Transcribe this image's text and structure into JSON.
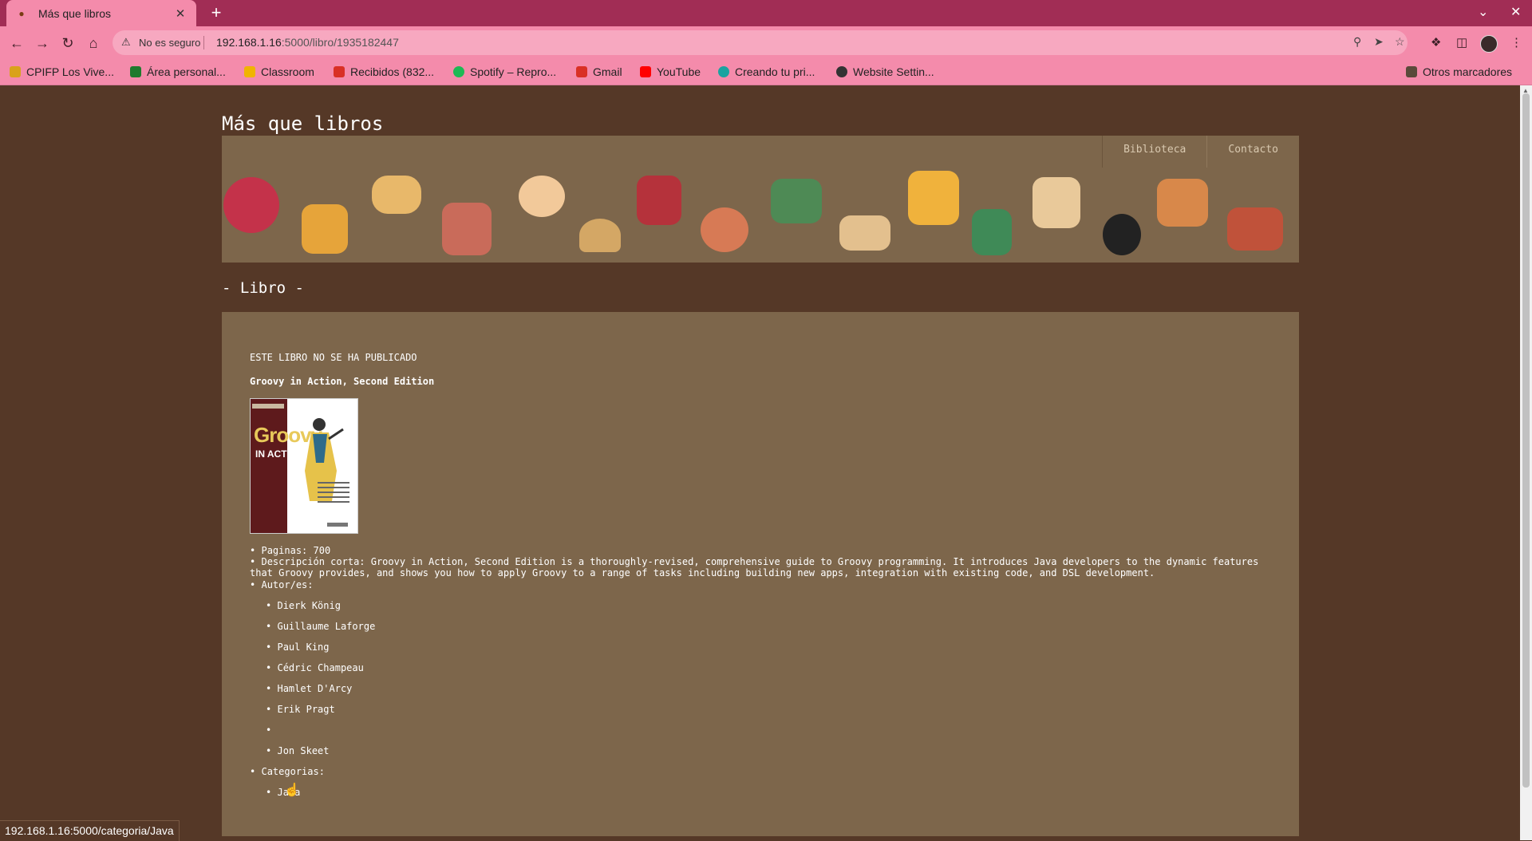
{
  "browser": {
    "tab_title": "Más que libros",
    "new_tab": "+",
    "tab_close": "✕",
    "security_label": "No es seguro",
    "url_host": "192.168.1.16",
    "url_path": ":5000/libro/1935182447",
    "window_controls": [
      "⌄",
      "✕"
    ],
    "bookmarks": [
      {
        "label": "CPIFP Los Vive...",
        "color": "#d9a21b"
      },
      {
        "label": "Área personal...",
        "color": "#1f7a2e"
      },
      {
        "label": "Classroom",
        "color": "#f0b400"
      },
      {
        "label": "Recibidos (832...",
        "color": "#d93025"
      },
      {
        "label": "Spotify – Repro...",
        "color": "#1db954"
      },
      {
        "label": "Gmail",
        "color": "#d93025"
      },
      {
        "label": "YouTube",
        "color": "#ff0000"
      },
      {
        "label": "Creando tu pri...",
        "color": "#1aa3a0"
      },
      {
        "label": "Website Settin...",
        "color": "#333333"
      }
    ],
    "other_bookmarks": "Otros marcadores",
    "status_url": "192.168.1.16:5000/categoria/Java"
  },
  "site": {
    "title": "Más que libros",
    "menu": [
      "Biblioteca",
      "Contacto"
    ],
    "section_title": "- Libro -"
  },
  "book": {
    "status": "ESTE LIBRO NO SE HA PUBLICADO",
    "title": "Groovy in Action, Second Edition",
    "cover_word": "Groovy",
    "cover_word2": "IN ACTION",
    "pages_label": "Paginas: 700",
    "description_line1": "Descripción corta: Groovy in Action, Second Edition is a thoroughly-revised, comprehensive guide to Groovy programming. It introduces Java developers to the dynamic features",
    "description_line2": "that Groovy provides, and shows you how to apply Groovy to a range of tasks including building new apps, integration with existing code, and DSL development.",
    "authors_label": "Autor/es:",
    "authors": [
      "Dierk König",
      "Guillaume Laforge",
      "Paul King",
      "Cédric Champeau",
      "Hamlet D'Arcy",
      "Erik Pragt",
      "",
      "Jon Skeet"
    ],
    "categories_label": "Categorias:",
    "categories": [
      "Java"
    ]
  },
  "colors": {
    "tab_bar": "#a12d55",
    "toolbar": "#f48bab",
    "page_background": "#553827",
    "panel": "#7d664b"
  }
}
